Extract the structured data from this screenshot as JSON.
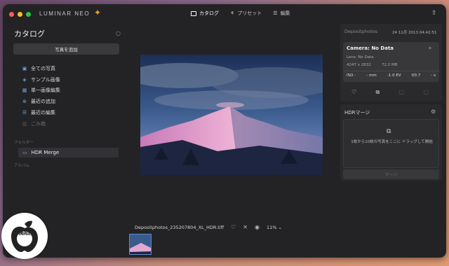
{
  "app": {
    "brand": "LUMINAR NEO"
  },
  "topnav": {
    "catalog": "カタログ",
    "presets": "プリセット",
    "edit": "編集"
  },
  "sidebar": {
    "title": "カタログ",
    "add_button": "写真を追加",
    "items": [
      {
        "label": "全ての写真",
        "icon": "photos-icon"
      },
      {
        "label": "サンプル画像",
        "icon": "cap-icon"
      },
      {
        "label": "単一画像編集",
        "icon": "grid-icon"
      },
      {
        "label": "最近の追加",
        "icon": "plus-circle-icon"
      },
      {
        "label": "最近の編集",
        "icon": "sliders-icon"
      },
      {
        "label": "ごみ箱",
        "icon": "trash-icon"
      }
    ],
    "folders_label": "フォルダー",
    "folder": "HDR Merge",
    "albums_label": "アルバム"
  },
  "filebar": {
    "filename": "Depositphotos_235207804_XL_HDR.tiff",
    "zoom": "11%"
  },
  "info": {
    "header": "Depositphotos",
    "date": "24 11月 2013 04:42:51",
    "camera": "Camera: No Data",
    "lens": "Lens: No Data",
    "dimensions": "4247 x 2832",
    "filesize": "72.2 MB",
    "iso": "ISO -",
    "focal": "- mm",
    "ev": "-1.0 EV",
    "aperture": "f/0.7",
    "shutter": "- s"
  },
  "hdr": {
    "title": "HDRマージ",
    "drop_text": "1枚から10枚の写真をここに ドラッグして開始",
    "merge_button": "マージ"
  },
  "badge": {
    "text": "検済定"
  }
}
